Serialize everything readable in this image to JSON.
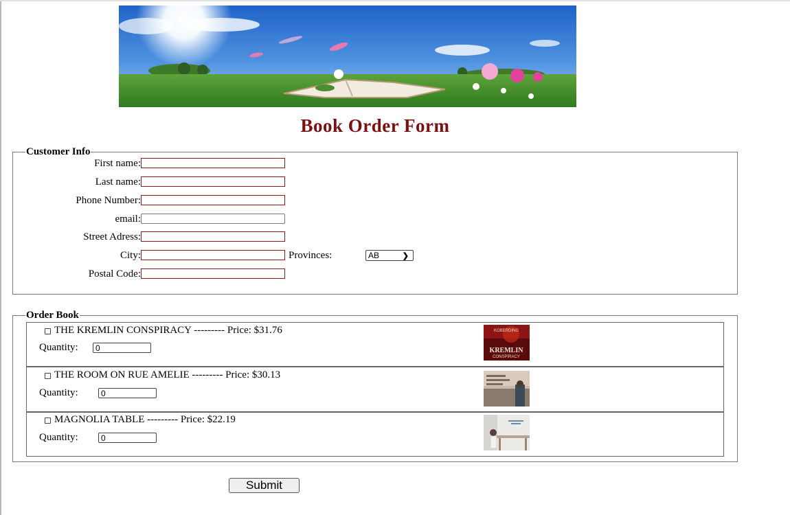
{
  "page": {
    "title": "Book Order Form"
  },
  "customer": {
    "legend": "Customer Info",
    "fields": [
      {
        "label": "First name:",
        "value": ""
      },
      {
        "label": "Last name:",
        "value": ""
      },
      {
        "label": "Phone Number:",
        "value": ""
      },
      {
        "label": "email:",
        "value": ""
      },
      {
        "label": "Street Adress:",
        "value": ""
      },
      {
        "label": "City:",
        "value": ""
      },
      {
        "label": "Postal Code:",
        "value": ""
      }
    ],
    "province_label": "Provinces:",
    "province_value": "AB"
  },
  "order": {
    "legend": "Order Book",
    "books": [
      {
        "name": "THE KREMLIN CONSPIRACY",
        "dashes": "---------",
        "price_label": "Price: $31.76",
        "qty_label": "Quantity:",
        "qty_value": "0",
        "cover_text_top": "KOBERDING",
        "cover_text_main": "KREMLIN",
        "cover_text_sub": "CONSPIRACY"
      },
      {
        "name": "THE ROOM ON RUE AMELIE",
        "dashes": "---------",
        "price_label": "Price: $30.13",
        "qty_label": "Quantity:",
        "qty_value": "0"
      },
      {
        "name": "MAGNOLIA TABLE",
        "dashes": "---------",
        "price_label": "Price: $22.19",
        "qty_label": "Quantity:",
        "qty_value": "0"
      }
    ]
  },
  "submit_label": "Submit",
  "colors": {
    "title": "#7a1010",
    "required_border": "#8b1a1a"
  }
}
